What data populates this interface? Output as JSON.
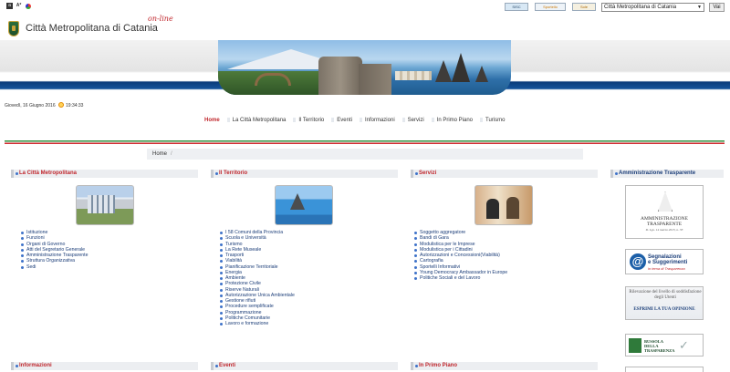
{
  "topbar": {
    "access_buttons": [
      "a",
      "A*"
    ],
    "logos": [
      "SISC",
      "Sportello",
      "Sole"
    ],
    "city_select": "Città Metropolitana di Catania",
    "go_button": "Vai"
  },
  "header": {
    "site_title": "Città Metropolitana di Catania",
    "online_tag": "on-line"
  },
  "date": {
    "day": "Giovedì, 16 Giugno 2016",
    "time": "19:34:33"
  },
  "nav": {
    "items": [
      "Home",
      "La Città Metropolitana",
      "Il Territorio",
      "Eventi",
      "Informazioni",
      "Servizi",
      "In Primo Piano",
      "Turismo"
    ]
  },
  "breadcrumb": {
    "home": "Home",
    "sep": "/"
  },
  "columns": {
    "citta": {
      "title": "La Città Metropolitana",
      "links": [
        "Istituzione",
        "Funzioni",
        "Organi di Governo",
        "Atti del Segretario Generale",
        "Amministrazione Trasparente",
        "Struttura Organizzativa",
        "Sedi"
      ]
    },
    "territorio": {
      "title": "Il Territorio",
      "links": [
        "I 58 Comuni della Provincia",
        "Scuola e Università",
        "Turismo",
        "La Rete Museale",
        "Trasporti",
        "Viabilità",
        "Pianificazione Territoriale",
        "Energia",
        "Ambiente",
        "Protezione Civile",
        "Riserve Naturali",
        "Autorizzazione Unica Ambientale",
        "Gestione rifiuti",
        "Procedure semplificate",
        "Programmazione",
        "Politiche Comunitarie",
        "Lavoro e formazione"
      ]
    },
    "servizi": {
      "title": "Servizi",
      "links": [
        "Soggetto aggregatore",
        "Bandi di Gara",
        "Modulistica per le Imprese",
        "Modulistica per i Cittadini",
        "Autorizzazioni e Concessioni(Viabilità)",
        "Cartografia",
        "Sportelli Informativi",
        "Young Democracy Ambassador in Europe",
        "Politiche Sociali e del Lavoro"
      ]
    },
    "bottom": {
      "informazioni": "Informazioni",
      "eventi": "Eventi",
      "primo_piano": "In Primo Piano"
    }
  },
  "sidebar": {
    "title": "Amministrazione Trasparente",
    "trasparente": {
      "line1": "AMMINISTRAZIONE",
      "line2": "TRASPARENTE",
      "line3": "D. Lgs. 14 marzo 2013, n. 33"
    },
    "segnalazioni": {
      "line1": "Segnalazioni",
      "line2": "e Suggerimenti",
      "line3": "in tema di Trasparenza"
    },
    "rilevazione": {
      "line1": "Rilevazione del livello di soddisfazione degli Utenti",
      "line2": "ESPRIMI LA TUA OPINIONE"
    },
    "bussola": {
      "line1": "BUSSOLA",
      "line2": "DELLA",
      "line3": "TRASPARENZA"
    }
  }
}
